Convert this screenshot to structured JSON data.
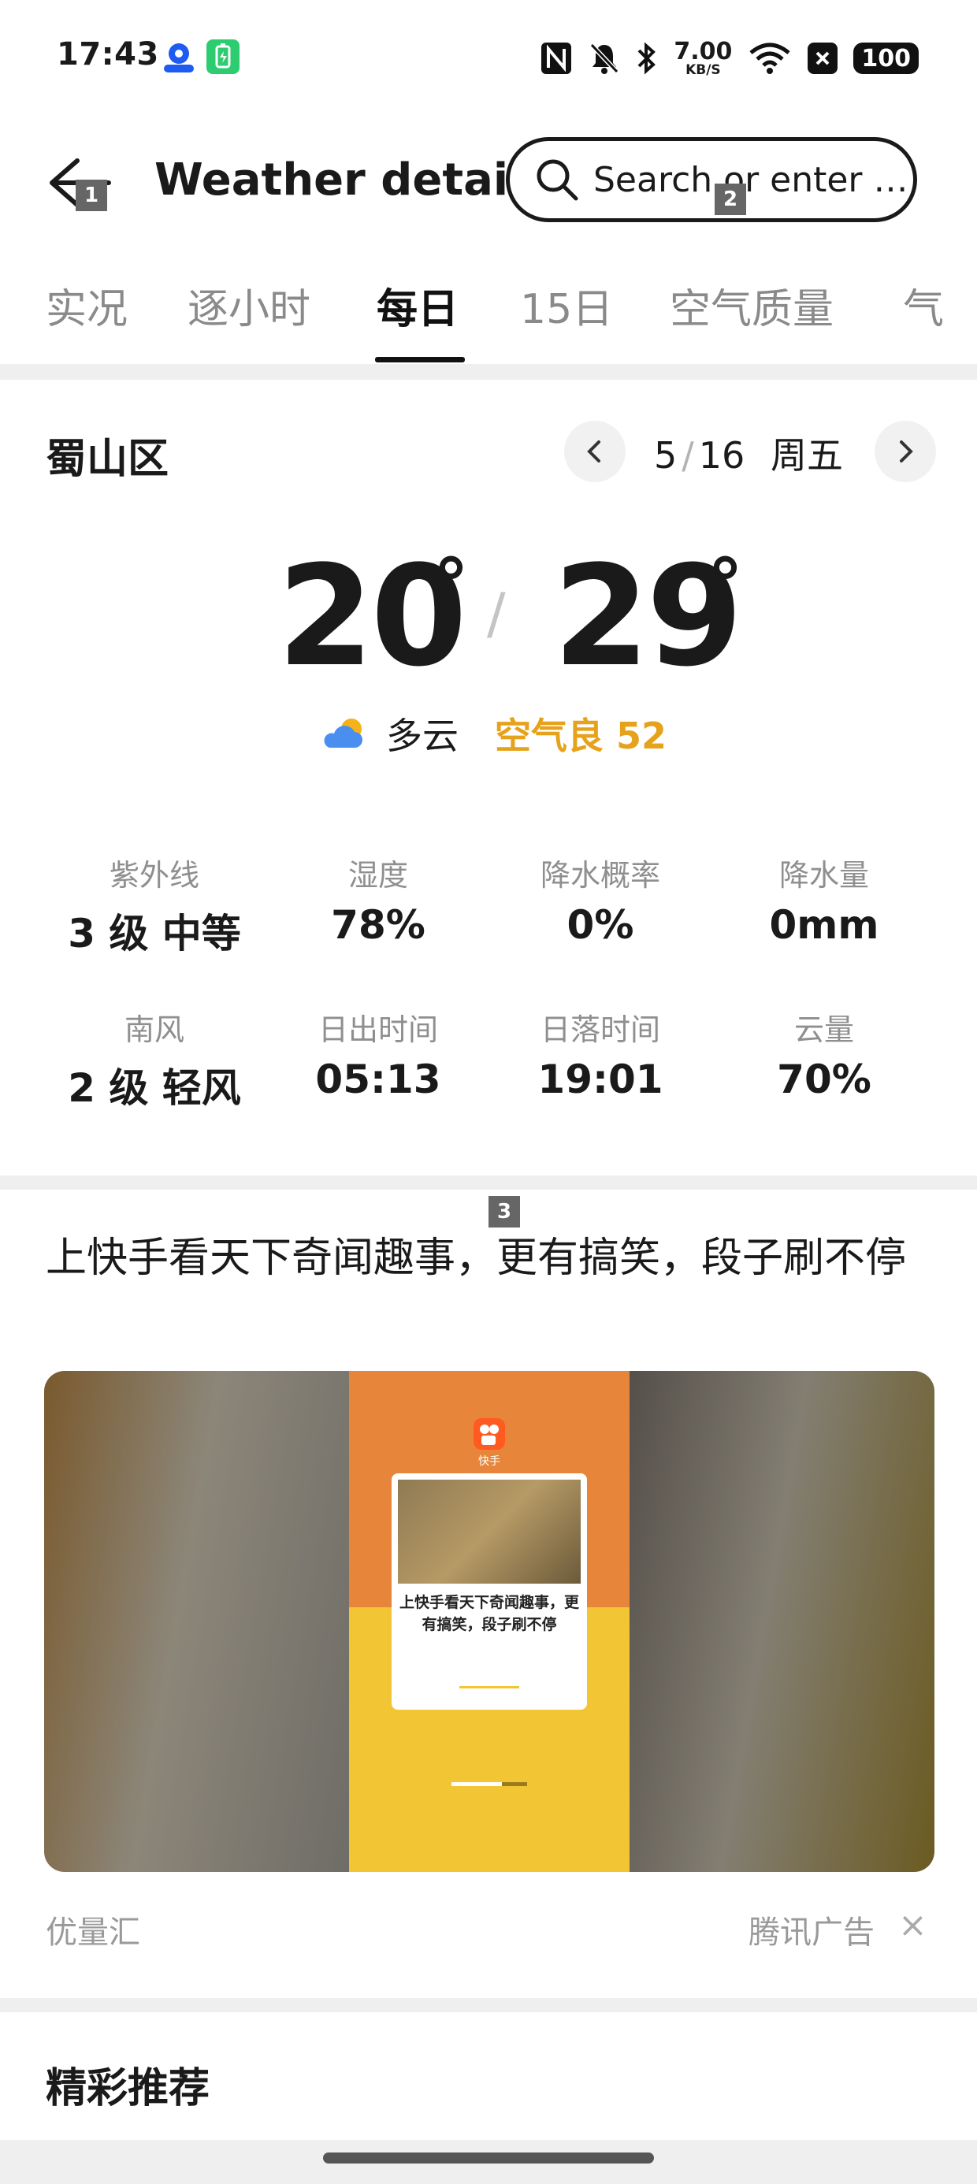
{
  "status_bar": {
    "time": "17:43",
    "net_speed_value": "7.00",
    "net_speed_unit": "KB/S",
    "battery": "100",
    "icons": [
      "location-app-icon",
      "battery-app-icon",
      "nfc-icon",
      "mute-icon",
      "bluetooth-icon",
      "wifi-icon",
      "close-box-icon"
    ]
  },
  "header": {
    "title": "Weather details",
    "search_placeholder": "Search or enter …",
    "markers": [
      "1",
      "2",
      "3"
    ]
  },
  "tabs": [
    {
      "label": "实况",
      "active": false
    },
    {
      "label": "逐小时",
      "active": false
    },
    {
      "label": "每日",
      "active": true
    },
    {
      "label": "15日",
      "active": false
    },
    {
      "label": "空气质量",
      "active": false
    },
    {
      "label": "气",
      "active": false
    }
  ],
  "weather": {
    "location": "蜀山区",
    "date_month": "5",
    "date_sep": "/",
    "date_day": "16",
    "weekday": "周五",
    "temp_low": "20",
    "temp_high": "29",
    "degree": "°",
    "slash": "/",
    "condition": "多云",
    "aqi_label": "空气良 52",
    "colors": {
      "aqi": "#e6a21a"
    },
    "details": [
      {
        "label": "紫外线",
        "value": "3 级 中等"
      },
      {
        "label": "湿度",
        "value": "78%"
      },
      {
        "label": "降水概率",
        "value": "0%"
      },
      {
        "label": "降水量",
        "value": "0mm"
      },
      {
        "label": "南风",
        "value": "2 级 轻风"
      },
      {
        "label": "日出时间",
        "value": "05:13"
      },
      {
        "label": "日落时间",
        "value": "19:01"
      },
      {
        "label": "云量",
        "value": "70%"
      }
    ]
  },
  "ad": {
    "title": "上快手看天下奇闻趣事，更有搞笑，段子刷不停",
    "app_name": "快手",
    "card_text": "上快手看天下奇闻趣事，更有搞笑，段子刷不停",
    "source": "优量汇",
    "provider": "腾讯广告",
    "close": "×"
  },
  "recommend": {
    "title": "精彩推荐"
  }
}
